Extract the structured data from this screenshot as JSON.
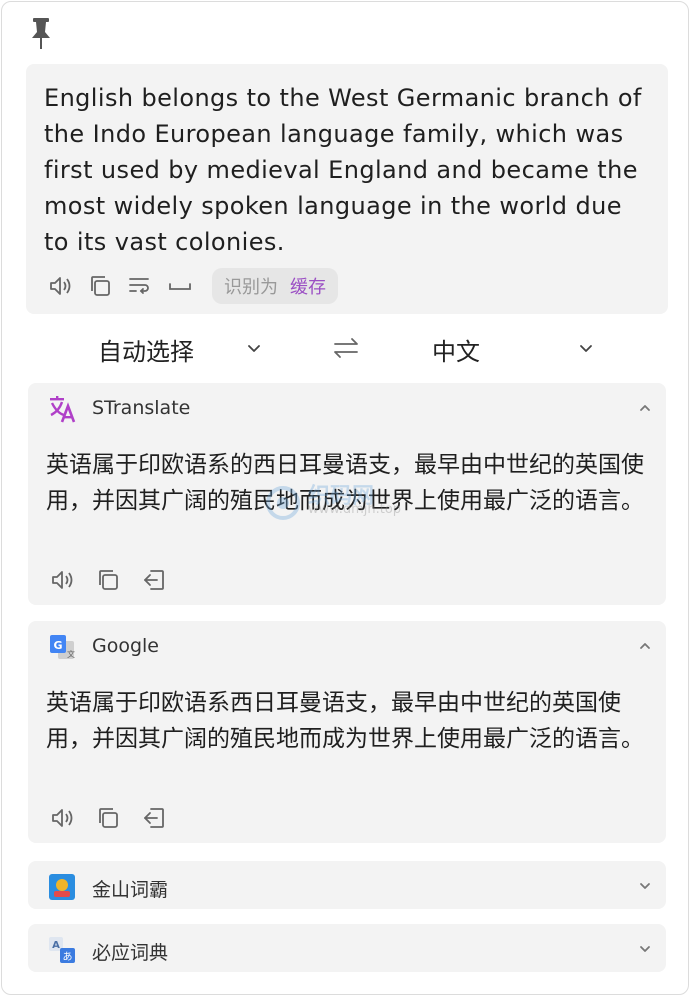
{
  "input": {
    "text": "English belongs to the West Germanic branch of the Indo European language family, which was first used by medieval England and became the most widely spoken language in the world due to its vast colonies.",
    "detect_label": "识别为",
    "detect_value": "缓存",
    "tools": [
      "speaker-icon",
      "copy-icon",
      "wrap-text-icon",
      "space-icon"
    ]
  },
  "languages": {
    "source": "自动选择",
    "target": "中文"
  },
  "services": [
    {
      "name": "STranslate",
      "icon": "stranslate-logo-icon",
      "expanded": true,
      "result": "英语属于印欧语系的西日耳曼语支，最早由中世纪的英国使用，并因其广阔的殖民地而成为世界上使用最广泛的语言。",
      "tools": [
        "speaker-icon",
        "copy-icon",
        "insert-icon"
      ]
    },
    {
      "name": "Google",
      "icon": "google-translate-icon",
      "expanded": true,
      "result": "英语属于印欧语系西日耳曼语支，最早由中世纪的英国使用，并因其广阔的殖民地而成为世界上使用最广泛的语言。",
      "tools": [
        "speaker-icon",
        "copy-icon",
        "insert-icon"
      ]
    },
    {
      "name": "金山词霸",
      "icon": "iciba-icon",
      "expanded": false
    },
    {
      "name": "必应词典",
      "icon": "bing-dict-icon",
      "expanded": false
    }
  ],
  "watermark": {
    "title": "织码网",
    "url": "www.dmjh.top"
  },
  "colors": {
    "accent_purple": "#9b4fc4",
    "card_bg": "#f3f3f3",
    "pill_bg": "#e6e6e6",
    "icon_gray": "#666666"
  }
}
